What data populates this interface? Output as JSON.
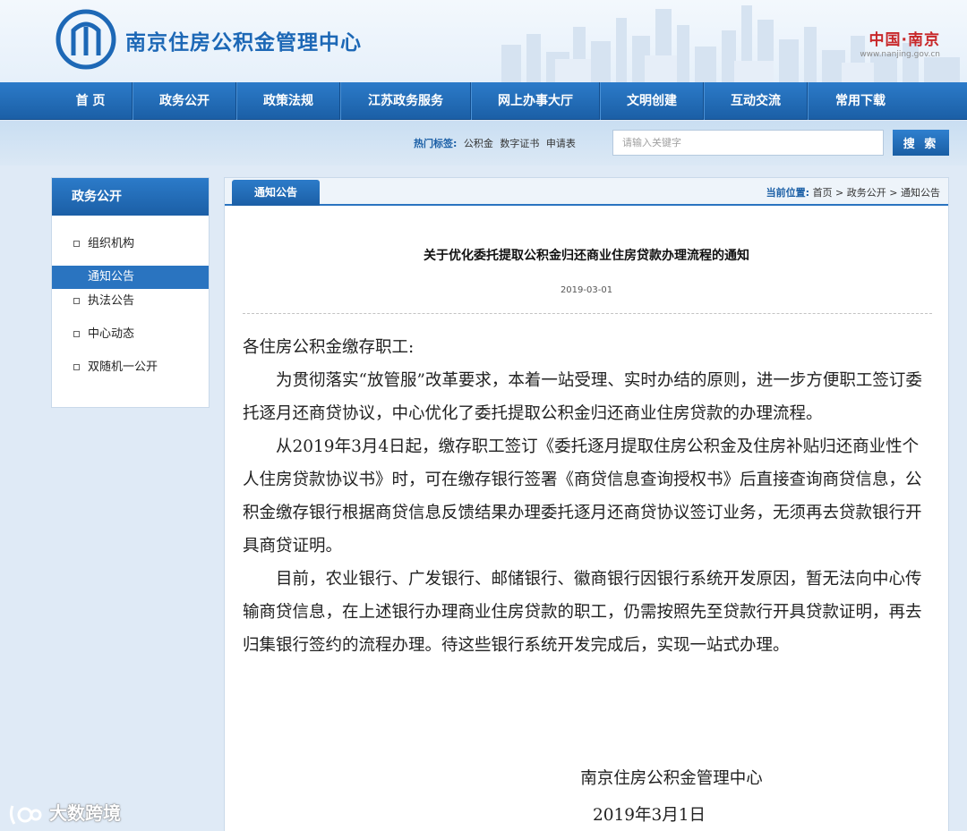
{
  "header": {
    "site_title": "南京住房公积金管理中心",
    "city_brand": "中国·南京",
    "city_url": "www.nanjing.gov.cn"
  },
  "nav": {
    "items": [
      "首 页",
      "政务公开",
      "政策法规",
      "江苏政务服务",
      "网上办事大厅",
      "文明创建",
      "互动交流",
      "常用下载"
    ]
  },
  "search": {
    "hot_label": "热门标签:",
    "tags": [
      "公积金",
      "数字证书",
      "申请表"
    ],
    "placeholder": "请输入关键字",
    "button_label": "搜 索"
  },
  "sidebar": {
    "title": "政务公开",
    "items": [
      {
        "label": "组织机构",
        "active": false
      },
      {
        "label": "通知公告",
        "active": true
      },
      {
        "label": "执法公告",
        "active": false
      },
      {
        "label": "中心动态",
        "active": false
      },
      {
        "label": "双随机一公开",
        "active": false
      }
    ]
  },
  "main": {
    "tab_label": "通知公告",
    "breadcrumb": {
      "label": "当前位置:",
      "items": [
        "首页",
        "政务公开",
        "通知公告"
      ],
      "separator": " > "
    },
    "article": {
      "title": "关于优化委托提取公积金归还商业住房贷款办理流程的通知",
      "date": "2019-03-01",
      "salutation": "各住房公积金缴存职工:",
      "paragraphs": [
        "为贯彻落实“放管服”改革要求，本着一站受理、实时办结的原则，进一步方便职工签订委托逐月还商贷协议，中心优化了委托提取公积金归还商业住房贷款的办理流程。",
        "从2019年3月4日起，缴存职工签订《委托逐月提取住房公积金及住房补贴归还商业性个人住房贷款协议书》时，可在缴存银行签署《商贷信息查询授权书》后直接查询商贷信息，公积金缴存银行根据商贷信息反馈结果办理委托逐月还商贷协议签订业务，无须再去贷款银行开具商贷证明。",
        "目前，农业银行、广发银行、邮储银行、徽商银行因银行系统开发原因，暂无法向中心传输商贷信息，在上述银行办理商业住房贷款的职工，仍需按照先至贷款行开具贷款证明，再去归集银行签约的流程办理。待这些银行系统开发完成后，实现一站式办理。"
      ],
      "signature_org": "南京住房公积金管理中心",
      "signature_date": "2019年3月1日"
    }
  },
  "watermark": {
    "text": "大数跨境"
  },
  "colors": {
    "primary_blue": "#1b5fa6",
    "nav_blue": "#2c7bc9",
    "brand_red": "#c8282a",
    "page_bg": "#dfeaf6"
  }
}
